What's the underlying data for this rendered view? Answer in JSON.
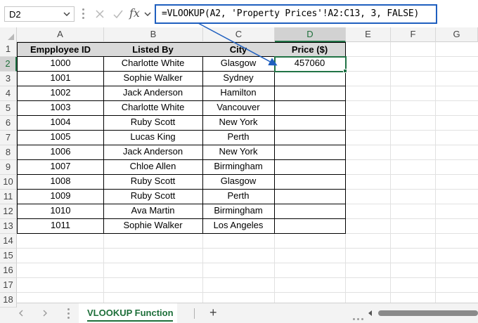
{
  "formula_bar": {
    "name_box": "D2",
    "fx_label": "fx",
    "formula": "=VLOOKUP(A2, 'Property Prices'!A2:C13, 3, FALSE)"
  },
  "columns": [
    "A",
    "B",
    "C",
    "D",
    "E",
    "F",
    "G"
  ],
  "rows": [
    "1",
    "2",
    "3",
    "4",
    "5",
    "6",
    "7",
    "8",
    "9",
    "10",
    "11",
    "12",
    "13",
    "14",
    "15",
    "16",
    "17",
    "18"
  ],
  "table": {
    "headers": [
      "Empployee ID",
      "Listed By",
      "City",
      "Price ($)"
    ],
    "rows": [
      [
        "1000",
        "Charlotte White",
        "Glasgow",
        "457060"
      ],
      [
        "1001",
        "Sophie Walker",
        "Sydney",
        ""
      ],
      [
        "1002",
        "Jack Anderson",
        "Hamilton",
        ""
      ],
      [
        "1003",
        "Charlotte White",
        "Vancouver",
        ""
      ],
      [
        "1004",
        "Ruby Scott",
        "New York",
        ""
      ],
      [
        "1005",
        "Lucas King",
        "Perth",
        ""
      ],
      [
        "1006",
        "Jack Anderson",
        "New York",
        ""
      ],
      [
        "1007",
        "Chloe Allen",
        "Birmingham",
        ""
      ],
      [
        "1008",
        "Ruby Scott",
        "Glasgow",
        ""
      ],
      [
        "1009",
        "Ruby Scott",
        "Perth",
        ""
      ],
      [
        "1010",
        "Ava Martin",
        "Birmingham",
        ""
      ],
      [
        "1011",
        "Sophie Walker",
        "Los Angeles",
        ""
      ]
    ]
  },
  "selection": {
    "active_column": "D",
    "active_row": "2"
  },
  "sheet_tabs": {
    "active": "VLOOKUP Function",
    "add_label": "+"
  },
  "colors": {
    "accent_green": "#217346",
    "formula_border": "#1f5fbf",
    "header_fill": "#d9d9d9"
  }
}
